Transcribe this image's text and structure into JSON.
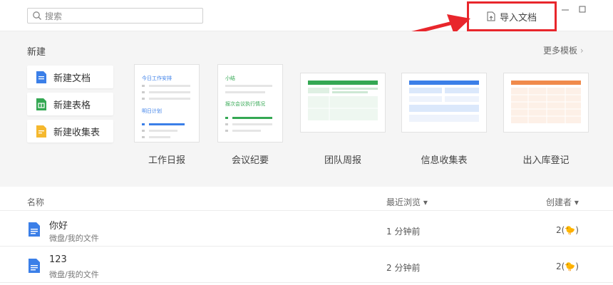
{
  "search": {
    "placeholder": "搜索"
  },
  "toolbar": {
    "import_label": "导入文档"
  },
  "window": {
    "minimize": "—",
    "maximize": "□"
  },
  "new_section": {
    "title": "新建",
    "more_label": "更多模板",
    "buttons": [
      {
        "label": "新建文档",
        "color": "#3b7fe8"
      },
      {
        "label": "新建表格",
        "color": "#34a853"
      },
      {
        "label": "新建收集表",
        "color": "#f5b82e"
      }
    ]
  },
  "templates": [
    {
      "label": "工作日报",
      "line1": "今日工作安排",
      "line2": "明日计划"
    },
    {
      "label": "会议纪要",
      "line1": "小结",
      "line2": "报次会议执行情况"
    },
    {
      "label": "团队周报"
    },
    {
      "label": "信息收集表"
    },
    {
      "label": "出入库登记"
    }
  ],
  "list": {
    "col_name": "名称",
    "col_recent": "最近浏览 ▾",
    "col_creator": "创建者 ▾",
    "rows": [
      {
        "name": "你好",
        "path": "微盘/我的文件",
        "time": "1 分钟前",
        "creator": "2(🐤)"
      },
      {
        "name": "123",
        "path": "微盘/我的文件",
        "time": "2 分钟前",
        "creator": "2(🐤)"
      }
    ]
  },
  "colors": {
    "accent_red": "#e8262c",
    "doc_blue": "#3b7fe8",
    "sheet_green": "#34a853",
    "form_yellow": "#f5b82e"
  }
}
